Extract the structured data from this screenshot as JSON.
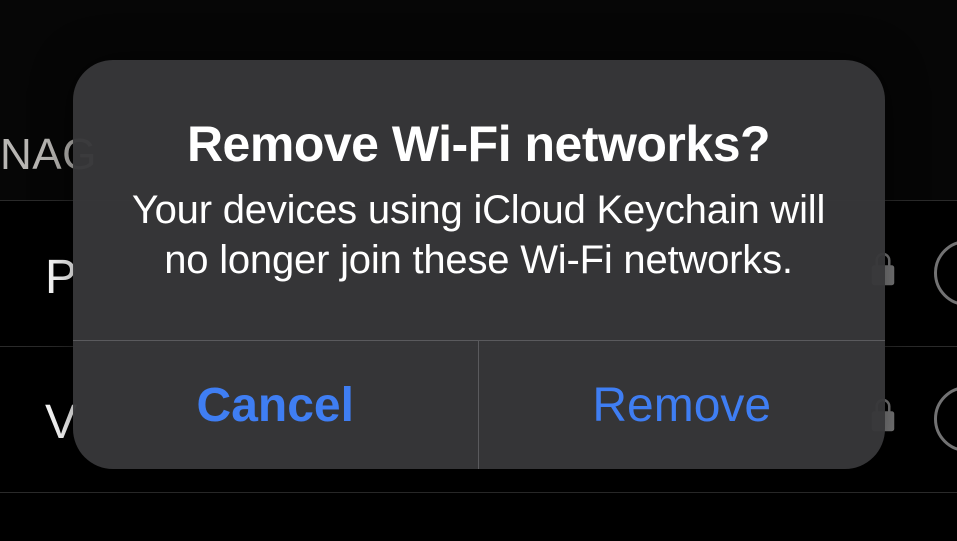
{
  "background": {
    "section_header_fragment": "NAG",
    "row1_initial": "P",
    "row2_initial": "V"
  },
  "alert": {
    "title": "Remove Wi-Fi networks?",
    "message": "Your devices using iCloud Keychain will no longer join these Wi-Fi networks.",
    "cancel_label": "Cancel",
    "confirm_label": "Remove"
  }
}
